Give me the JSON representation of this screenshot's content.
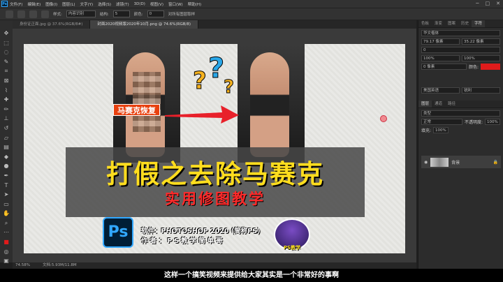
{
  "menubar": {
    "logo": "Ps",
    "items": [
      "文件(F)",
      "编辑(E)",
      "图像(I)",
      "图层(L)",
      "文字(Y)",
      "选择(S)",
      "滤镜(T)",
      "3D(D)",
      "视图(V)",
      "窗口(W)",
      "帮助(H)"
    ]
  },
  "options": {
    "mode_label": "样式:",
    "mode_value": "内容识别",
    "feather_label": "结构:",
    "feather_value": "5",
    "color_label": "颜色:",
    "color_value": "0",
    "check_label": "对所有图层取样"
  },
  "tabs": [
    {
      "label": "身份证正面.jpg @ 37.6%(RGB/8#)"
    },
    {
      "label": "封面2020视频版2020年10月.png @ 74.6%(RGB/8)"
    }
  ],
  "document": {
    "badge": "马赛克恢复",
    "title": "打假之去除马赛克",
    "subtitle": "实用修图教学",
    "ps_logo": "Ps",
    "software_line": "软件：PHOTOSHOP 2020 (简称PS)",
    "author_line": "作者：PS教学简单哥",
    "avatar_label": "PS教学"
  },
  "status": {
    "zoom": "74.58%",
    "doc": "文档:5.93M/11.8M"
  },
  "caption": "这样一个搞笑视频来提供给大家其实是一个非常好的事啊",
  "panel": {
    "tabs": [
      "色板",
      "渐变",
      "图案",
      "历史",
      "字符"
    ],
    "font_family": "华文楷体",
    "size": "79.17 像素",
    "leading": "35.22 像素",
    "tracking": "0",
    "scale_v": "100%",
    "scale_h": "100%",
    "baseline": "0 像素",
    "color_label": "颜色:",
    "language": "美国英语",
    "aa": "锐利",
    "layers_tabs": [
      "图层",
      "通道",
      "路径"
    ],
    "layers_filter": "类型",
    "mode": "正常",
    "opacity_label": "不透明度:",
    "opacity": "100%",
    "fill_label": "填充:",
    "fill": "100%",
    "layer_name": "背景"
  },
  "colors": {
    "accent": "#31a8ff",
    "title": "#ffdd1e",
    "subtitle": "#ff2a2a"
  }
}
